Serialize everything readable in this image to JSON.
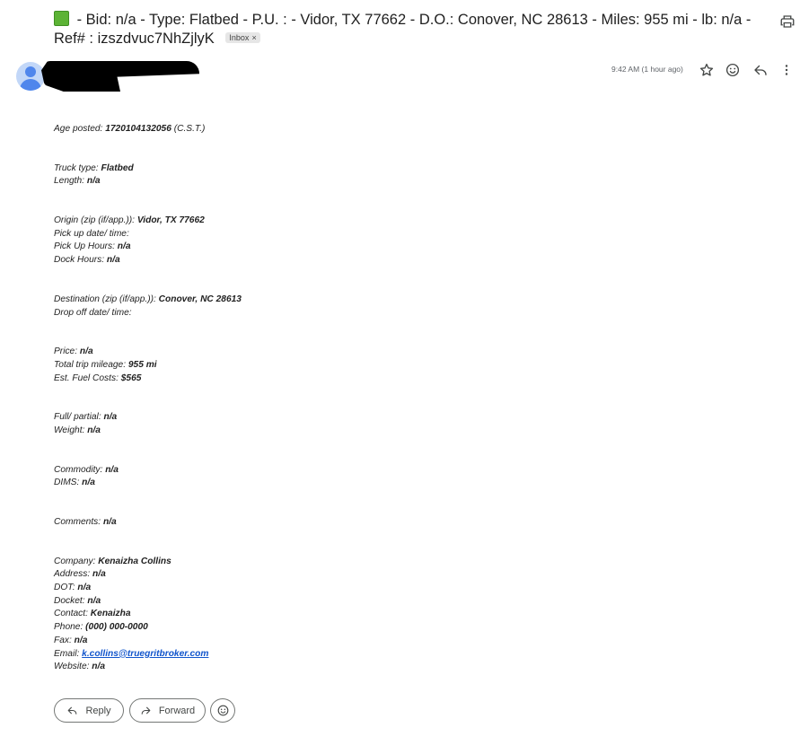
{
  "subject": {
    "text": "- Bid: n/a - Type: Flatbed - P.U. : - Vidor, TX 77662 - D.O.: Conover, NC 28613 - Miles: 955 mi - lb: n/a - Ref# : izszdvuc7NhZjlyK",
    "status_emoji": "green-square-emoji",
    "label_badge": "Inbox",
    "label_remove": "×"
  },
  "header_icons": {
    "print": "print-icon",
    "star": "star-icon",
    "react": "smiley-icon",
    "reply": "reply-icon",
    "more": "more-vert-icon"
  },
  "message": {
    "time": "9:42 AM (1 hour ago)",
    "groups": [
      [
        {
          "label": "Age posted:",
          "value": "1720104132056",
          "suffix": "(C.S.T.)"
        }
      ],
      [
        {
          "label": "Truck type:",
          "value": "Flatbed"
        },
        {
          "label": "Length:",
          "value": "n/a"
        }
      ],
      [
        {
          "label": "Origin (zip (if/app.)):",
          "value": "Vidor, TX 77662"
        },
        {
          "label": "Pick up date/ time:",
          "value": ""
        },
        {
          "label": "Pick Up Hours:",
          "value": "n/a"
        },
        {
          "label": "Dock Hours:",
          "value": "n/a"
        }
      ],
      [
        {
          "label": "Destination (zip (if/app.)):",
          "value": "Conover, NC 28613"
        },
        {
          "label": "Drop off date/ time:",
          "value": ""
        }
      ],
      [
        {
          "label": "Price:",
          "value": "n/a"
        },
        {
          "label": "Total trip mileage:",
          "value": "955 mi"
        },
        {
          "label": "Est. Fuel Costs:",
          "value": "$565"
        }
      ],
      [
        {
          "label": "Full/ partial:",
          "value": "n/a"
        },
        {
          "label": "Weight:",
          "value": "n/a"
        }
      ],
      [
        {
          "label": "Commodity:",
          "value": "n/a"
        },
        {
          "label": "DIMS:",
          "value": "n/a"
        }
      ],
      [
        {
          "label": "Comments:",
          "value": "n/a"
        }
      ],
      [
        {
          "label": "Company:",
          "value": "Kenaizha Collins"
        },
        {
          "label": "Address:",
          "value": "n/a"
        },
        {
          "label": "DOT:",
          "value": "n/a"
        },
        {
          "label": "Docket:",
          "value": "n/a"
        },
        {
          "label": "Contact:",
          "value": "Kenaizha"
        },
        {
          "label": "Phone:",
          "value": "(000) 000-0000"
        },
        {
          "label": "Fax:",
          "value": "n/a"
        },
        {
          "label": "Email:",
          "value": "k.collins@truegritbroker.com",
          "link": true
        },
        {
          "label": "Website:",
          "value": "n/a"
        }
      ]
    ]
  },
  "actions": {
    "reply_label": "Reply",
    "forward_label": "Forward",
    "react_icon": "add-reaction-icon"
  }
}
